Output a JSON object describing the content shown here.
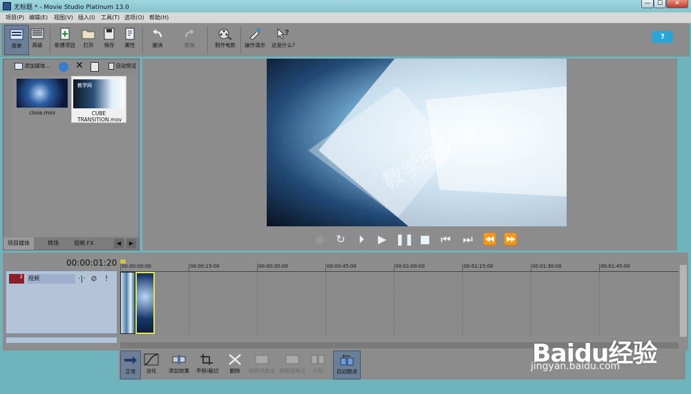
{
  "window": {
    "title": "无标题 * - Movie Studio Platinum 13.0",
    "minimize": "—",
    "maximize": "☐",
    "close": "✕"
  },
  "menu": [
    "项目(P)",
    "编辑(E)",
    "视图(V)",
    "插入(I)",
    "工具(T)",
    "选项(O)",
    "帮助(H)"
  ],
  "toolbar": {
    "simple": "简单",
    "advanced": "高级",
    "new_project": "新建项目",
    "open": "打开",
    "save": "保存",
    "properties": "属性",
    "undo": "撤消",
    "redo": "重做",
    "make_movie": "制作电影",
    "show_me_how": "操作演示",
    "whats_this": "这是什么?",
    "help": "?"
  },
  "media": {
    "add_media": "添加媒体...",
    "auto_preview": "自动预览",
    "items": [
      {
        "name": "close.mov"
      },
      {
        "name": "CUBE TRANSITION.mov",
        "thumb_text": "教学网"
      }
    ],
    "tabs": [
      "项目媒体",
      "转场",
      "视频 FX"
    ],
    "tab_prev": "◀",
    "tab_next": "▶"
  },
  "preview": {
    "watermark_text": "教学网 ⋅ 网"
  },
  "timeline": {
    "timecode": "00:00:01:20",
    "track": {
      "number": "2",
      "name": "视频"
    },
    "ruler": [
      "00:00:00:00",
      "00:00:15:00",
      "00:00:30:00",
      "00:00:45:00",
      "00:01:00:00",
      "00:01:15:00",
      "00:01:30:00",
      "00:01:45:00"
    ]
  },
  "edit_toolbar": {
    "normal": "正常",
    "fade": "淡化",
    "add_effect": "添加效果",
    "pan_crop": "平移/裁切",
    "delete": "删除",
    "trim_start": "修剪开始点",
    "trim_end": "修剪结束点",
    "split": "分割",
    "auto_ripple": "自动跟进"
  },
  "watermark": {
    "brand": "Baidu经验",
    "url": "jingyan.baidu.com"
  }
}
